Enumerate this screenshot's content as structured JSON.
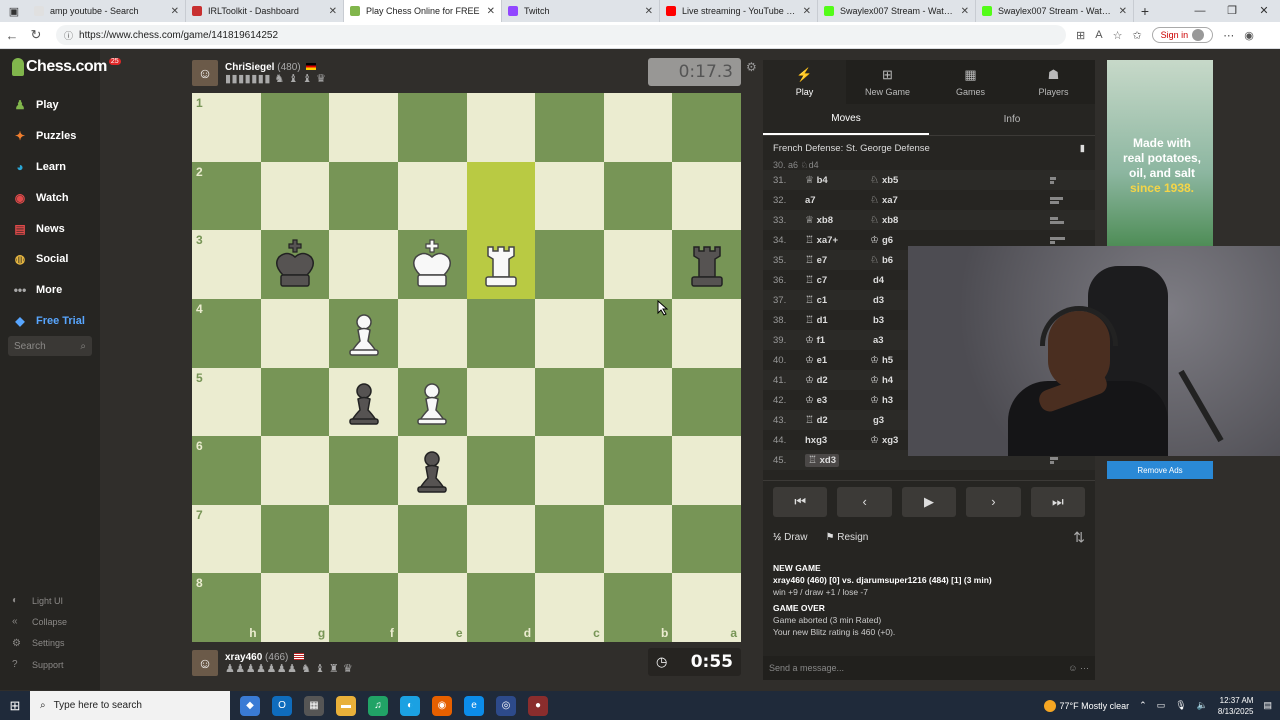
{
  "browser": {
    "tabs": [
      {
        "title": "amp youtube - Search",
        "color": "#e0e0e0"
      },
      {
        "title": "IRLToolkit - Dashboard",
        "color": "#c83030"
      },
      {
        "title": "Play Chess Online for FREE",
        "color": "#81b64c"
      },
      {
        "title": "Twitch",
        "color": "#9146ff"
      },
      {
        "title": "Live streaming - YouTube Studio",
        "color": "#ff0000"
      },
      {
        "title": "Swaylex007 Stream - Watch Live",
        "color": "#53fc18"
      },
      {
        "title": "Swaylex007 Stream - Watch Live",
        "color": "#53fc18"
      }
    ],
    "url": "https://www.chess.com/game/141819614252",
    "sign_in": "Sign in"
  },
  "sidebar": {
    "logo": "Chess.com",
    "logo_badge": "25",
    "items": [
      {
        "label": "Play",
        "icon": "play-icon"
      },
      {
        "label": "Puzzles",
        "icon": "puzzle-icon"
      },
      {
        "label": "Learn",
        "icon": "learn-icon"
      },
      {
        "label": "Watch",
        "icon": "watch-icon"
      },
      {
        "label": "News",
        "icon": "news-icon"
      },
      {
        "label": "Social",
        "icon": "social-icon"
      },
      {
        "label": "More",
        "icon": "more-icon"
      },
      {
        "label": "Free Trial",
        "icon": "diamond-icon"
      }
    ],
    "search_placeholder": "Search",
    "bottom": [
      {
        "label": "Light UI",
        "icon": "light-ui-icon"
      },
      {
        "label": "Collapse",
        "icon": "collapse-icon"
      },
      {
        "label": "Settings",
        "icon": "settings-icon"
      },
      {
        "label": "Support",
        "icon": "support-icon"
      }
    ]
  },
  "top_player": {
    "name": "ChriSiegel",
    "rating": "(480)",
    "captured": "▮▮▮▮▮▮▮ ♞ ♝ ♝ ♛",
    "clock": "0:17.3"
  },
  "bottom_player": {
    "name": "xray460",
    "rating": "(466)",
    "captured": "♟♟♟♟♟♟♟ ♞ ♝ ♜ ♛",
    "clock": "0:55"
  },
  "board": {
    "ranks": [
      "1",
      "2",
      "3",
      "4",
      "5",
      "6",
      "7",
      "8"
    ],
    "files": [
      "h",
      "g",
      "f",
      "e",
      "d",
      "c",
      "b",
      "a"
    ],
    "highlight": [
      "d2",
      "d3"
    ],
    "pieces": [
      {
        "square": "g3",
        "piece": "bK"
      },
      {
        "square": "e3",
        "piece": "wK"
      },
      {
        "square": "d3",
        "piece": "wR"
      },
      {
        "square": "a3",
        "piece": "bR"
      },
      {
        "square": "f4",
        "piece": "wP"
      },
      {
        "square": "f5",
        "piece": "bP"
      },
      {
        "square": "e5",
        "piece": "wP"
      },
      {
        "square": "e6",
        "piece": "bP"
      }
    ]
  },
  "panel": {
    "tabs": [
      {
        "label": "Play",
        "icon": "play-lightning-icon"
      },
      {
        "label": "New Game",
        "icon": "new-game-icon"
      },
      {
        "label": "Games",
        "icon": "games-icon"
      },
      {
        "label": "Players",
        "icon": "players-icon"
      }
    ],
    "subtabs": [
      "Moves",
      "Info"
    ],
    "opening": "French Defense: St. George Defense",
    "moves": [
      {
        "n": "31.",
        "wp": "♕",
        "w": "b4",
        "bp": "♘",
        "b": "xb5"
      },
      {
        "n": "32.",
        "wp": "",
        "w": "a7",
        "bp": "♘",
        "b": "xa7"
      },
      {
        "n": "33.",
        "wp": "♕",
        "w": "xb8",
        "bp": "♘",
        "b": "xb8"
      },
      {
        "n": "34.",
        "wp": "♖",
        "w": "xa7+",
        "bp": "♔",
        "b": "g6"
      },
      {
        "n": "35.",
        "wp": "♖",
        "w": "e7",
        "bp": "♘",
        "b": "b6"
      },
      {
        "n": "36.",
        "wp": "♖",
        "w": "c7",
        "bp": "",
        "b": "d4"
      },
      {
        "n": "37.",
        "wp": "♖",
        "w": "c1",
        "bp": "",
        "b": "d3"
      },
      {
        "n": "38.",
        "wp": "♖",
        "w": "d1",
        "bp": "",
        "b": "b3"
      },
      {
        "n": "39.",
        "wp": "♔",
        "w": "f1",
        "bp": "",
        "b": "a3"
      },
      {
        "n": "40.",
        "wp": "♔",
        "w": "e1",
        "bp": "♔",
        "b": "h5"
      },
      {
        "n": "41.",
        "wp": "♔",
        "w": "d2",
        "bp": "♔",
        "b": "h4"
      },
      {
        "n": "42.",
        "wp": "♔",
        "w": "e3",
        "bp": "♔",
        "b": "h3"
      },
      {
        "n": "43.",
        "wp": "♖",
        "w": "d2",
        "bp": "",
        "b": "g3"
      },
      {
        "n": "44.",
        "wp": "",
        "w": "hxg3",
        "bp": "♔",
        "b": "xg3"
      },
      {
        "n": "45.",
        "wp": "♖",
        "w": "xd3",
        "bp": "",
        "b": ""
      }
    ],
    "actions": {
      "draw": "Draw",
      "draw_icon": "½",
      "resign": "Resign"
    },
    "chat": {
      "new_game_header": "NEW GAME",
      "new_game_line": "xray460 (460) [0] vs. djarumsuper1216 (484) [1] (3 min)",
      "new_game_odds": "win +9 / draw +1 / lose -7",
      "game_over_header": "GAME OVER",
      "game_over_line1": "Game aborted (3 min Rated)",
      "game_over_line2": "Your new Blitz rating is 460 (+0).",
      "input_placeholder": "Send a message..."
    }
  },
  "ad": {
    "line1": "Made with",
    "line2": "real potatoes,",
    "line3": "oil, and salt",
    "line4": "since 1938.",
    "remove": "Remove Ads"
  },
  "taskbar": {
    "search": "Type here to search",
    "weather": "77°F  Mostly clear",
    "time": "12:37 AM",
    "date": "8/13/2025"
  }
}
